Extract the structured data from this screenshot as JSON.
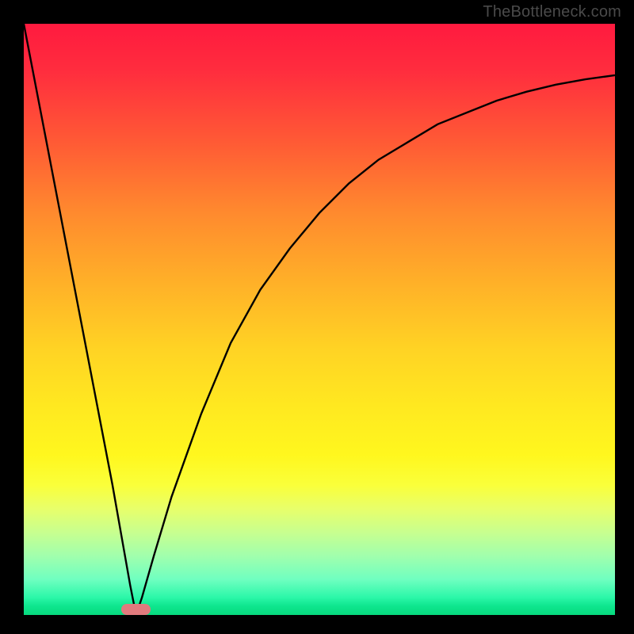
{
  "watermark": "TheBottleneck.com",
  "chart_data": {
    "type": "line",
    "title": "",
    "xlabel": "",
    "ylabel": "",
    "xlim": [
      0,
      100
    ],
    "ylim": [
      0,
      100
    ],
    "background_gradient": {
      "top": "#ff1a3f",
      "mid": "#ffe920",
      "bottom": "#07d97e"
    },
    "series": [
      {
        "name": "bottleneck-curve",
        "description": "V-shaped curve: steep linear descent to a minimum near x≈19, then asymptotic rise toward the right edge",
        "x": [
          0,
          5,
          10,
          15,
          18,
          19,
          20,
          22,
          25,
          30,
          35,
          40,
          45,
          50,
          55,
          60,
          65,
          70,
          75,
          80,
          85,
          90,
          95,
          100
        ],
        "y": [
          100,
          74,
          48,
          22,
          5,
          0,
          3,
          10,
          20,
          34,
          46,
          55,
          62,
          68,
          73,
          77,
          80,
          83,
          85,
          87,
          88.5,
          89.7,
          90.6,
          91.3
        ]
      }
    ],
    "marker": {
      "name": "optimal-marker",
      "x_center": 19,
      "width_pct": 5,
      "color": "#e17a7d"
    }
  }
}
